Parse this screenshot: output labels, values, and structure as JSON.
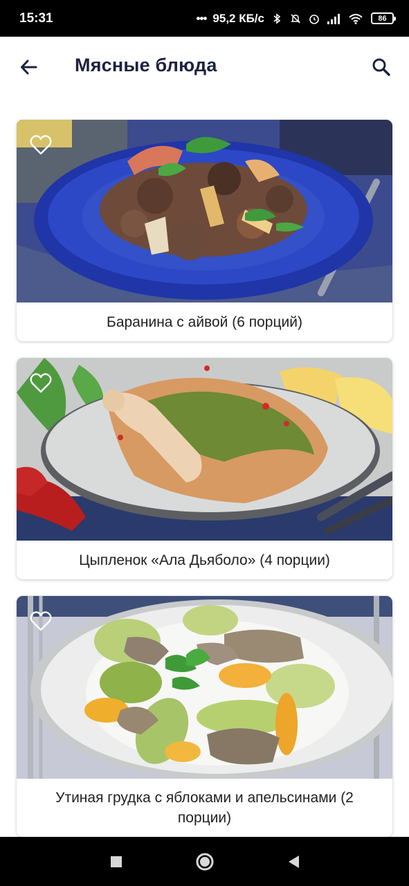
{
  "status_bar": {
    "time": "15:31",
    "network_speed": "95,2 КБ/с",
    "battery_level": "86",
    "icons": [
      "more-dots-icon",
      "bluetooth-icon",
      "mute-icon",
      "alarm-icon",
      "signal-icon",
      "wifi-icon",
      "battery-icon"
    ]
  },
  "app_bar": {
    "title": "Мясные блюда",
    "back_icon": "arrow-left-icon",
    "search_icon": "search-icon"
  },
  "recipes": [
    {
      "title": "Баранина с айвой (6 порций)",
      "favorite": false
    },
    {
      "title": "Цыпленок «Ала Дьяболо» (4 порции)",
      "favorite": false
    },
    {
      "title": "Утиная грудка с яблоками и апельсинами (2 порции)",
      "favorite": false
    }
  ],
  "nav_bar": {
    "icons": [
      "recents-square-icon",
      "home-circle-icon",
      "back-triangle-icon"
    ]
  },
  "colors": {
    "title_text": "#1c2240",
    "status_bar_bg": "#000000",
    "nav_bar_bg": "#000000",
    "card_bg": "#ffffff"
  }
}
